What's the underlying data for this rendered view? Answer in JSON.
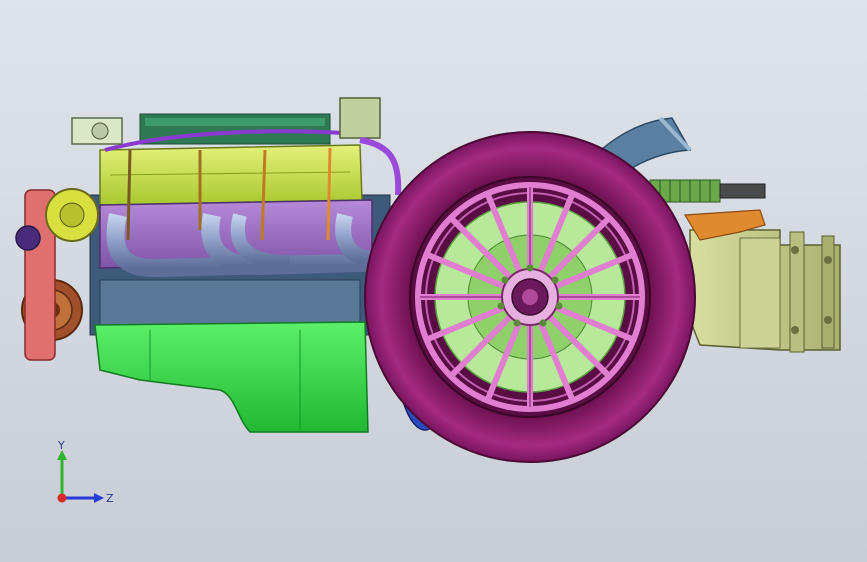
{
  "viewport": {
    "background_top": "#dfe3ea",
    "background_bottom": "#c7ccd5"
  },
  "model": {
    "parts": [
      "exhaust-header",
      "fuel-rail",
      "valve-cover",
      "intake-manifold",
      "oil-pan",
      "crank-pulley",
      "alternator",
      "wheel",
      "tire",
      "brake-disc",
      "hub-nut",
      "transaxle",
      "intake-duct",
      "suspension-spring"
    ],
    "colors": {
      "valve_cover": "#c6e04a",
      "intake_manifold": "#9a6fc2",
      "exhaust": "#8e9ec7",
      "oil_pan": "#39d94a",
      "tire": "#8f1b6b",
      "wheel_spokes": "#e07fd0",
      "brake_disc": "#8fe06a",
      "transaxle": "#c2c98a",
      "pulley": "#a0502a"
    }
  },
  "triad": {
    "y_label": "Y",
    "z_label": "Z",
    "y_color": "#2fb52f",
    "z_color": "#2a3ad6",
    "x_color": "#d62a2a"
  }
}
